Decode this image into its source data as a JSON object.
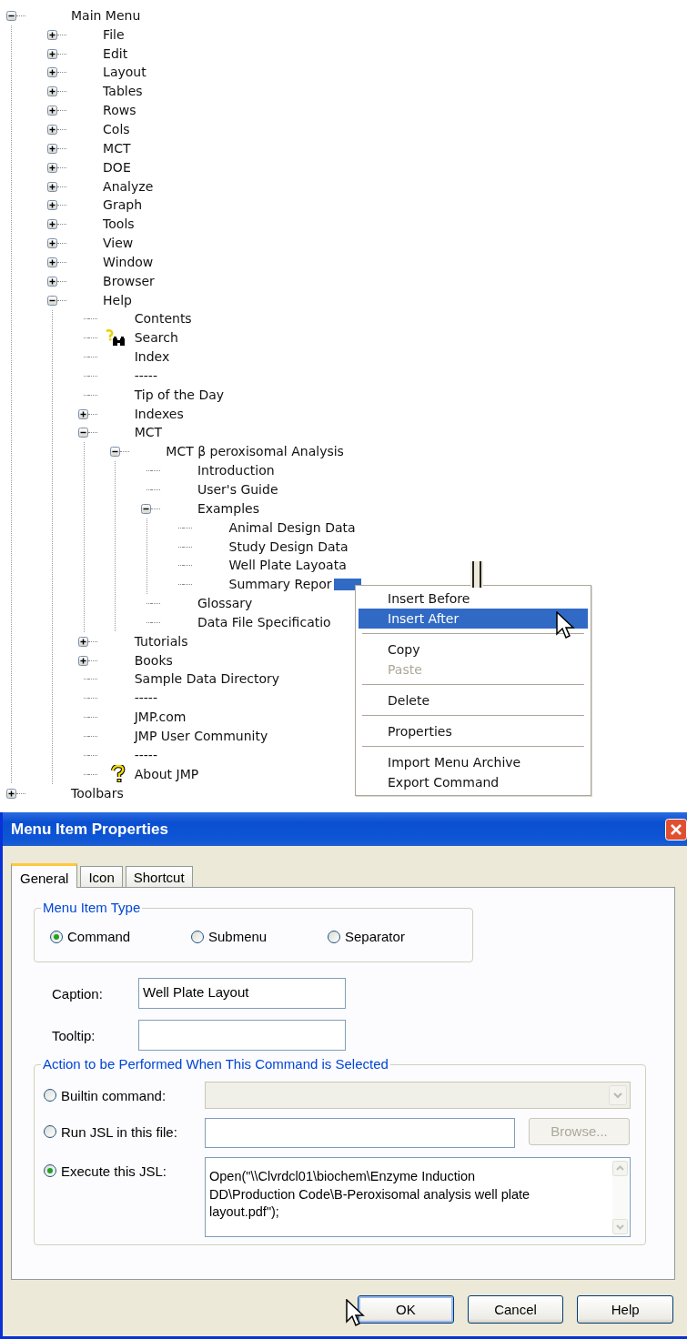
{
  "tree": [
    {
      "label": "Main Menu",
      "kind": "branch",
      "expanded": true,
      "selected": false,
      "children": [
        {
          "label": "File",
          "kind": "branch",
          "expanded": false,
          "selected": false
        },
        {
          "label": "Edit",
          "kind": "branch",
          "expanded": false,
          "selected": false
        },
        {
          "label": "Layout",
          "kind": "branch",
          "expanded": false,
          "selected": false
        },
        {
          "label": "Tables",
          "kind": "branch",
          "expanded": false,
          "selected": false
        },
        {
          "label": "Rows",
          "kind": "branch",
          "expanded": false,
          "selected": false
        },
        {
          "label": "Cols",
          "kind": "branch",
          "expanded": false,
          "selected": false
        },
        {
          "label": "MCT",
          "kind": "branch",
          "expanded": false,
          "selected": false
        },
        {
          "label": "DOE",
          "kind": "branch",
          "expanded": false,
          "selected": false
        },
        {
          "label": "Analyze",
          "kind": "branch",
          "expanded": false,
          "selected": false
        },
        {
          "label": "Graph",
          "kind": "branch",
          "expanded": false,
          "selected": false
        },
        {
          "label": "Tools",
          "kind": "branch",
          "expanded": false,
          "selected": false
        },
        {
          "label": "View",
          "kind": "branch",
          "expanded": false,
          "selected": false
        },
        {
          "label": "Window",
          "kind": "branch",
          "expanded": false,
          "selected": false
        },
        {
          "label": "Browser",
          "kind": "branch",
          "expanded": false,
          "selected": false
        },
        {
          "label": "Help",
          "kind": "branch",
          "expanded": true,
          "selected": false,
          "children": [
            {
              "label": "Contents",
              "kind": "leaf",
              "selected": false
            },
            {
              "label": "Search",
              "kind": "search_leaf",
              "selected": false
            },
            {
              "label": "Index",
              "kind": "leaf",
              "selected": false
            },
            {
              "label": "-----",
              "kind": "leaf",
              "selected": false
            },
            {
              "label": "Tip of the Day",
              "kind": "leaf",
              "selected": false
            },
            {
              "label": "Indexes",
              "kind": "branch",
              "expanded": false,
              "selected": false
            },
            {
              "label": "MCT",
              "kind": "branch",
              "expanded": true,
              "selected": false,
              "children": [
                {
                  "label": "MCT β peroxisomal Analysis",
                  "kind": "branch",
                  "expanded": true,
                  "selected": false,
                  "children": [
                    {
                      "label": "Introduction",
                      "kind": "leaf",
                      "selected": false
                    },
                    {
                      "label": "User's Guide",
                      "kind": "leaf",
                      "selected": false
                    },
                    {
                      "label": "Examples",
                      "kind": "branch",
                      "expanded": true,
                      "selected": false,
                      "children": [
                        {
                          "label": "Animal Design Data",
                          "kind": "leaf",
                          "selected": false
                        },
                        {
                          "label": "Study Design Data",
                          "kind": "leaf",
                          "selected": false
                        },
                        {
                          "label": "Well Plate Layoata",
                          "kind": "leaf",
                          "selected": false
                        },
                        {
                          "label": "Summary Repor",
                          "kind": "leaf",
                          "selected": true
                        }
                      ]
                    },
                    {
                      "label": "Glossary",
                      "kind": "leaf",
                      "selected": false
                    },
                    {
                      "label": "Data File Specificatio",
                      "kind": "leaf",
                      "selected": false
                    }
                  ]
                }
              ]
            },
            {
              "label": "Tutorials",
              "kind": "branch",
              "expanded": false,
              "selected": false
            },
            {
              "label": "Books",
              "kind": "branch",
              "expanded": false,
              "selected": false
            },
            {
              "label": "Sample Data Directory",
              "kind": "leaf",
              "selected": false
            },
            {
              "label": "-----",
              "kind": "leaf",
              "selected": false
            },
            {
              "label": "JMP.com",
              "kind": "leaf",
              "selected": false
            },
            {
              "label": "JMP User Community",
              "kind": "leaf",
              "selected": false
            },
            {
              "label": "-----",
              "kind": "leaf",
              "selected": false
            },
            {
              "label": "About JMP",
              "kind": "about_leaf",
              "selected": false
            }
          ]
        }
      ]
    },
    {
      "label": "Toolbars",
      "kind": "branch",
      "expanded": false,
      "selected": false
    }
  ],
  "context_menu": [
    {
      "kind": "item",
      "label": "Insert Before",
      "selected": false,
      "disabled": false
    },
    {
      "kind": "item",
      "label": "Insert After",
      "selected": true,
      "disabled": false
    },
    {
      "kind": "separator"
    },
    {
      "kind": "item",
      "label": "Copy",
      "selected": false,
      "disabled": false
    },
    {
      "kind": "item",
      "label": "Paste",
      "selected": false,
      "disabled": true
    },
    {
      "kind": "separator"
    },
    {
      "kind": "item",
      "label": "Delete",
      "selected": false,
      "disabled": false
    },
    {
      "kind": "separator"
    },
    {
      "kind": "item",
      "label": "Properties",
      "selected": false,
      "disabled": false
    },
    {
      "kind": "separator"
    },
    {
      "kind": "item",
      "label": "Import Menu Archive",
      "selected": false,
      "disabled": false
    },
    {
      "kind": "item",
      "label": "Export Command",
      "selected": false,
      "disabled": false
    }
  ],
  "dialog": {
    "title": "Menu Item Properties",
    "tabs": [
      {
        "label": "General",
        "selected": true
      },
      {
        "label": "Icon",
        "selected": false
      },
      {
        "label": "Shortcut",
        "selected": false
      }
    ],
    "menu_item_type": {
      "legend": "Menu Item Type",
      "options": [
        {
          "label": "Command",
          "selected": true
        },
        {
          "label": "Submenu",
          "selected": false
        },
        {
          "label": "Separator",
          "selected": false
        }
      ]
    },
    "fields": [
      {
        "label": "Caption:",
        "value": "Well Plate Layout"
      },
      {
        "label": "Tooltip:"
      }
    ],
    "action": {
      "legend": "Action to be Performed When This Command is Selected",
      "options": [
        {
          "label": "Builtin command:",
          "selected": false,
          "kind": "dropdown",
          "disabled": true
        },
        {
          "label": "Run JSL in this file:",
          "selected": false,
          "kind": "file",
          "button": {
            "label": "Browse...",
            "disabled": true
          }
        },
        {
          "label": "Execute this JSL:",
          "selected": true,
          "kind": "script",
          "value": "Open(\"\\\\Clvrdcl01\\biochem\\Enzyme Induction\nDD\\Production Code\\B-Peroxisomal analysis well plate\nlayout.pdf\");"
        }
      ]
    },
    "buttons": [
      {
        "label": "OK",
        "default": true
      },
      {
        "label": "Cancel",
        "default": false
      },
      {
        "label": "Help",
        "default": false
      }
    ]
  }
}
